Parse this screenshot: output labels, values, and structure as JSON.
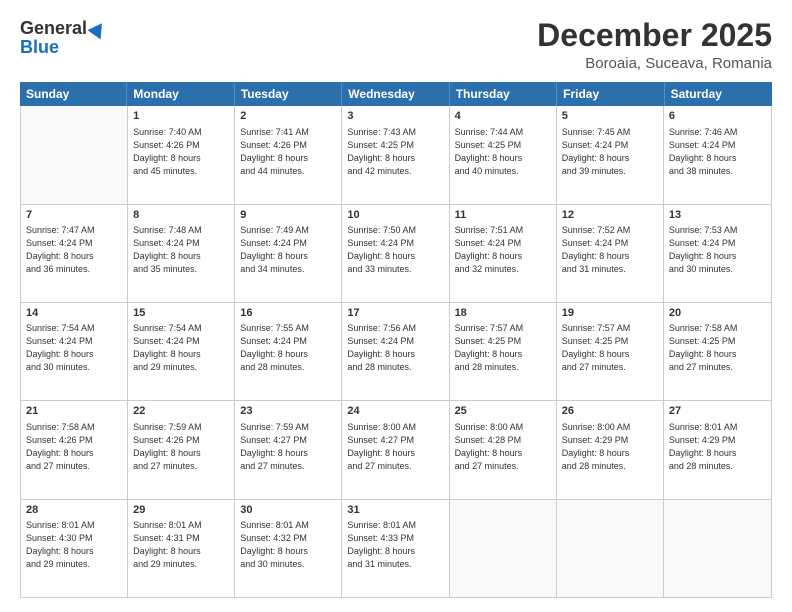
{
  "logo": {
    "general": "General",
    "blue": "Blue"
  },
  "title": "December 2025",
  "location": "Boroaia, Suceava, Romania",
  "header_days": [
    "Sunday",
    "Monday",
    "Tuesday",
    "Wednesday",
    "Thursday",
    "Friday",
    "Saturday"
  ],
  "weeks": [
    [
      {
        "day": "",
        "info": ""
      },
      {
        "day": "1",
        "info": "Sunrise: 7:40 AM\nSunset: 4:26 PM\nDaylight: 8 hours\nand 45 minutes."
      },
      {
        "day": "2",
        "info": "Sunrise: 7:41 AM\nSunset: 4:26 PM\nDaylight: 8 hours\nand 44 minutes."
      },
      {
        "day": "3",
        "info": "Sunrise: 7:43 AM\nSunset: 4:25 PM\nDaylight: 8 hours\nand 42 minutes."
      },
      {
        "day": "4",
        "info": "Sunrise: 7:44 AM\nSunset: 4:25 PM\nDaylight: 8 hours\nand 40 minutes."
      },
      {
        "day": "5",
        "info": "Sunrise: 7:45 AM\nSunset: 4:24 PM\nDaylight: 8 hours\nand 39 minutes."
      },
      {
        "day": "6",
        "info": "Sunrise: 7:46 AM\nSunset: 4:24 PM\nDaylight: 8 hours\nand 38 minutes."
      }
    ],
    [
      {
        "day": "7",
        "info": "Sunrise: 7:47 AM\nSunset: 4:24 PM\nDaylight: 8 hours\nand 36 minutes."
      },
      {
        "day": "8",
        "info": "Sunrise: 7:48 AM\nSunset: 4:24 PM\nDaylight: 8 hours\nand 35 minutes."
      },
      {
        "day": "9",
        "info": "Sunrise: 7:49 AM\nSunset: 4:24 PM\nDaylight: 8 hours\nand 34 minutes."
      },
      {
        "day": "10",
        "info": "Sunrise: 7:50 AM\nSunset: 4:24 PM\nDaylight: 8 hours\nand 33 minutes."
      },
      {
        "day": "11",
        "info": "Sunrise: 7:51 AM\nSunset: 4:24 PM\nDaylight: 8 hours\nand 32 minutes."
      },
      {
        "day": "12",
        "info": "Sunrise: 7:52 AM\nSunset: 4:24 PM\nDaylight: 8 hours\nand 31 minutes."
      },
      {
        "day": "13",
        "info": "Sunrise: 7:53 AM\nSunset: 4:24 PM\nDaylight: 8 hours\nand 30 minutes."
      }
    ],
    [
      {
        "day": "14",
        "info": "Sunrise: 7:54 AM\nSunset: 4:24 PM\nDaylight: 8 hours\nand 30 minutes."
      },
      {
        "day": "15",
        "info": "Sunrise: 7:54 AM\nSunset: 4:24 PM\nDaylight: 8 hours\nand 29 minutes."
      },
      {
        "day": "16",
        "info": "Sunrise: 7:55 AM\nSunset: 4:24 PM\nDaylight: 8 hours\nand 28 minutes."
      },
      {
        "day": "17",
        "info": "Sunrise: 7:56 AM\nSunset: 4:24 PM\nDaylight: 8 hours\nand 28 minutes."
      },
      {
        "day": "18",
        "info": "Sunrise: 7:57 AM\nSunset: 4:25 PM\nDaylight: 8 hours\nand 28 minutes."
      },
      {
        "day": "19",
        "info": "Sunrise: 7:57 AM\nSunset: 4:25 PM\nDaylight: 8 hours\nand 27 minutes."
      },
      {
        "day": "20",
        "info": "Sunrise: 7:58 AM\nSunset: 4:25 PM\nDaylight: 8 hours\nand 27 minutes."
      }
    ],
    [
      {
        "day": "21",
        "info": "Sunrise: 7:58 AM\nSunset: 4:26 PM\nDaylight: 8 hours\nand 27 minutes."
      },
      {
        "day": "22",
        "info": "Sunrise: 7:59 AM\nSunset: 4:26 PM\nDaylight: 8 hours\nand 27 minutes."
      },
      {
        "day": "23",
        "info": "Sunrise: 7:59 AM\nSunset: 4:27 PM\nDaylight: 8 hours\nand 27 minutes."
      },
      {
        "day": "24",
        "info": "Sunrise: 8:00 AM\nSunset: 4:27 PM\nDaylight: 8 hours\nand 27 minutes."
      },
      {
        "day": "25",
        "info": "Sunrise: 8:00 AM\nSunset: 4:28 PM\nDaylight: 8 hours\nand 27 minutes."
      },
      {
        "day": "26",
        "info": "Sunrise: 8:00 AM\nSunset: 4:29 PM\nDaylight: 8 hours\nand 28 minutes."
      },
      {
        "day": "27",
        "info": "Sunrise: 8:01 AM\nSunset: 4:29 PM\nDaylight: 8 hours\nand 28 minutes."
      }
    ],
    [
      {
        "day": "28",
        "info": "Sunrise: 8:01 AM\nSunset: 4:30 PM\nDaylight: 8 hours\nand 29 minutes."
      },
      {
        "day": "29",
        "info": "Sunrise: 8:01 AM\nSunset: 4:31 PM\nDaylight: 8 hours\nand 29 minutes."
      },
      {
        "day": "30",
        "info": "Sunrise: 8:01 AM\nSunset: 4:32 PM\nDaylight: 8 hours\nand 30 minutes."
      },
      {
        "day": "31",
        "info": "Sunrise: 8:01 AM\nSunset: 4:33 PM\nDaylight: 8 hours\nand 31 minutes."
      },
      {
        "day": "",
        "info": ""
      },
      {
        "day": "",
        "info": ""
      },
      {
        "day": "",
        "info": ""
      }
    ]
  ]
}
